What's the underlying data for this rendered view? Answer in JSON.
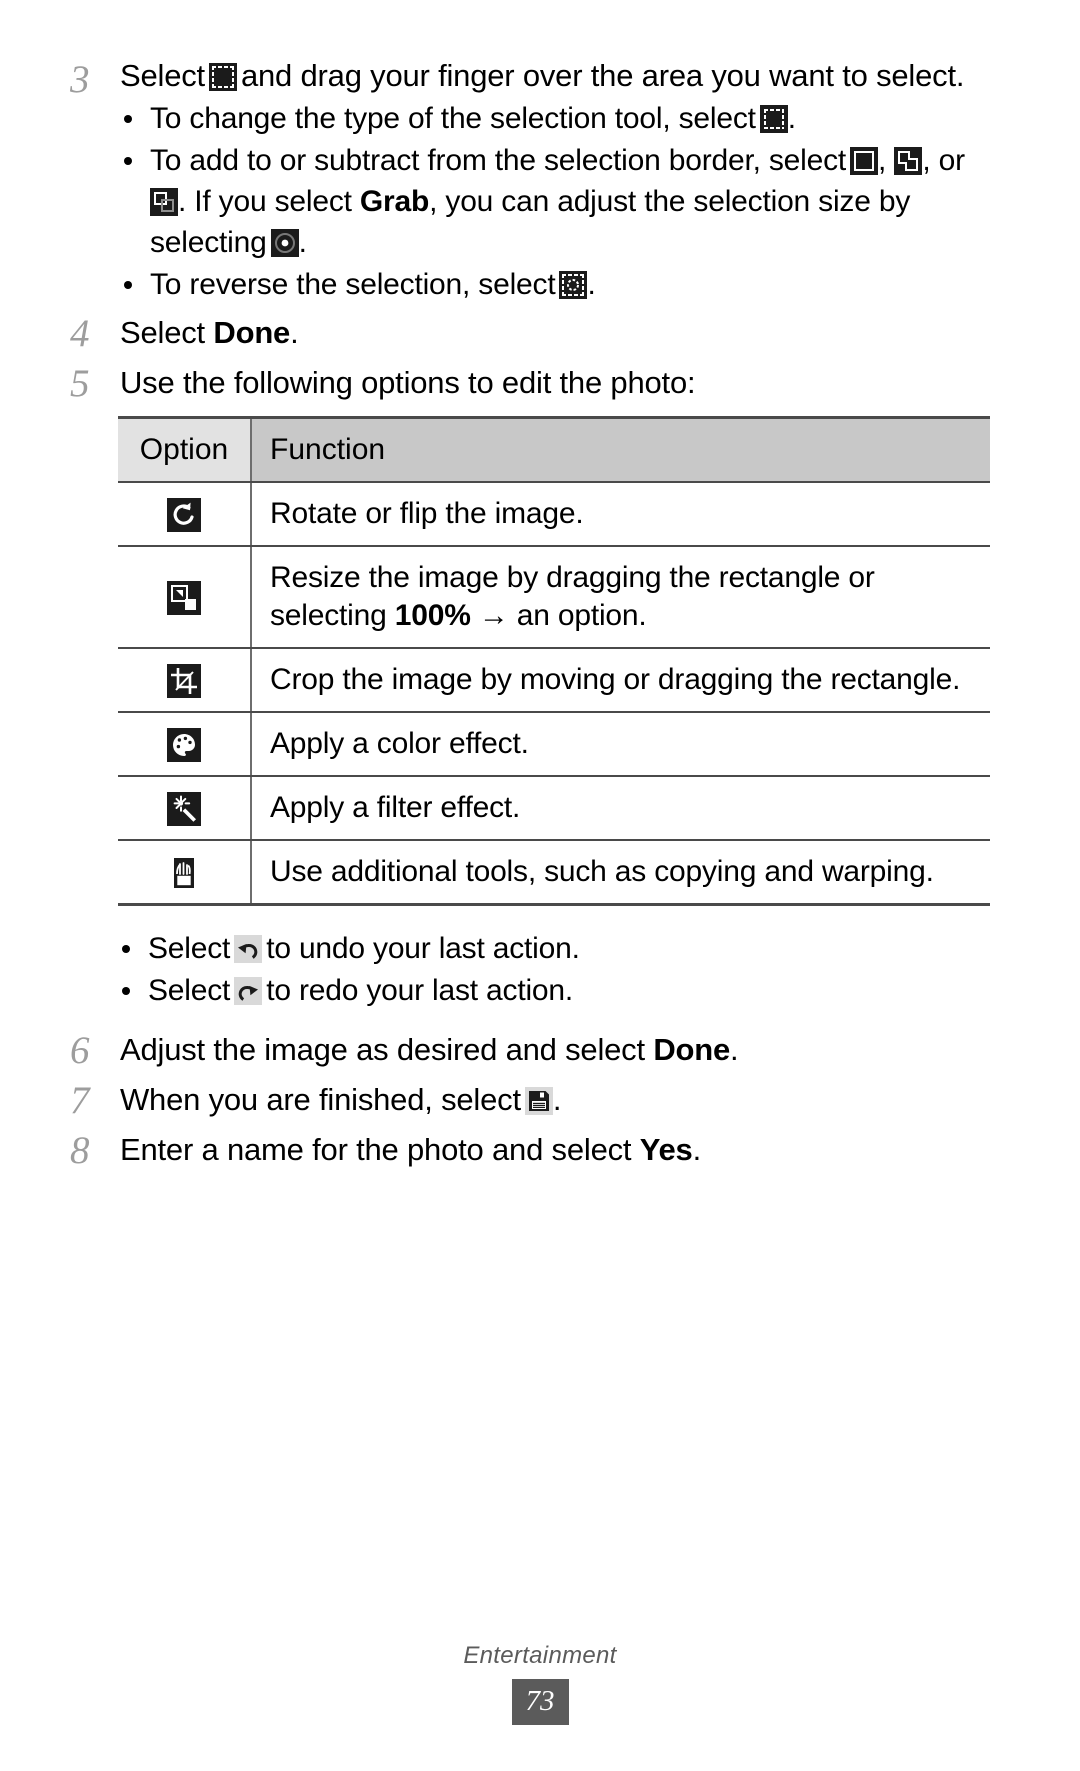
{
  "steps": [
    {
      "number": "3",
      "text_before": "Select",
      "icon": "selection-tool-icon",
      "text_after": "and drag your finger over the area you want to select.",
      "bullets": [
        {
          "text_before": "To change the type of the selection tool, select",
          "icon": "selection-type-icon",
          "text_after": "."
        },
        {
          "text_before": "To add to or subtract from the selection border, select",
          "icons": [
            "selection-replace-icon",
            "selection-add-icon",
            "selection-subtract-icon"
          ],
          "mid_text_1": ", ",
          "mid_text_2": ", or ",
          "mid_text_3": ". If you select ",
          "bold_word": "Grab",
          "mid_text_4": ", you can adjust the selection size by selecting",
          "icon_end": "grab-size-icon",
          "text_after": "."
        },
        {
          "text_before": "To reverse the selection, select",
          "icon": "invert-selection-icon",
          "text_after": "."
        }
      ]
    },
    {
      "number": "4",
      "text_before": "Select",
      "bold_word": "Done",
      "text_after": "."
    },
    {
      "number": "5",
      "text": "Use the following options to edit the photo:"
    }
  ],
  "table": {
    "headers": [
      "Option",
      "Function"
    ],
    "rows": [
      {
        "icon": "rotate-icon",
        "function_parts": [
          {
            "t": "Rotate or flip the image.",
            "bold": false
          }
        ]
      },
      {
        "icon": "resize-icon",
        "function_parts": [
          {
            "t": "Resize the image by dragging the rectangle or selecting ",
            "bold": false
          },
          {
            "t": "100%",
            "bold": true
          },
          {
            "t": " → an option.",
            "bold": false
          }
        ]
      },
      {
        "icon": "crop-icon",
        "function_parts": [
          {
            "t": "Crop the image by moving or dragging the rectangle.",
            "bold": false
          }
        ]
      },
      {
        "icon": "color-palette-icon",
        "function_parts": [
          {
            "t": "Apply a color effect.",
            "bold": false
          }
        ]
      },
      {
        "icon": "magic-wand-filter-icon",
        "function_parts": [
          {
            "t": "Apply a filter effect.",
            "bold": false
          }
        ]
      },
      {
        "icon": "additional-tools-icon",
        "function_parts": [
          {
            "t": "Use additional tools, such as copying and warping.",
            "bold": false
          }
        ]
      }
    ]
  },
  "post_table_bullets": [
    {
      "text_before": "Select",
      "icon": "undo-icon",
      "text_after": "to undo your last action."
    },
    {
      "text_before": "Select",
      "icon": "redo-icon",
      "text_after": "to redo your last action."
    }
  ],
  "final_steps": [
    {
      "number": "6",
      "text_before": "Adjust the image as desired and select",
      "bold_word": "Done",
      "text_after": "."
    },
    {
      "number": "7",
      "text_before": "When you are finished, select",
      "icon": "save-floppy-icon",
      "text_after": "."
    },
    {
      "number": "8",
      "text_before": "Enter a name for the photo and select",
      "bold_word": "Yes",
      "text_after": "."
    }
  ],
  "footer": {
    "section_title": "Entertainment",
    "page_number": "73"
  },
  "colors": {
    "icon_fill": "#1b1b1b",
    "header_option_bg": "#e2e2e2",
    "header_function_bg": "#c8c8c8",
    "rule": "#4a4a4a",
    "step_number": "#9d9d9d",
    "footer_text": "#5b5b5b",
    "page_badge_bg": "#5b5b5b"
  }
}
